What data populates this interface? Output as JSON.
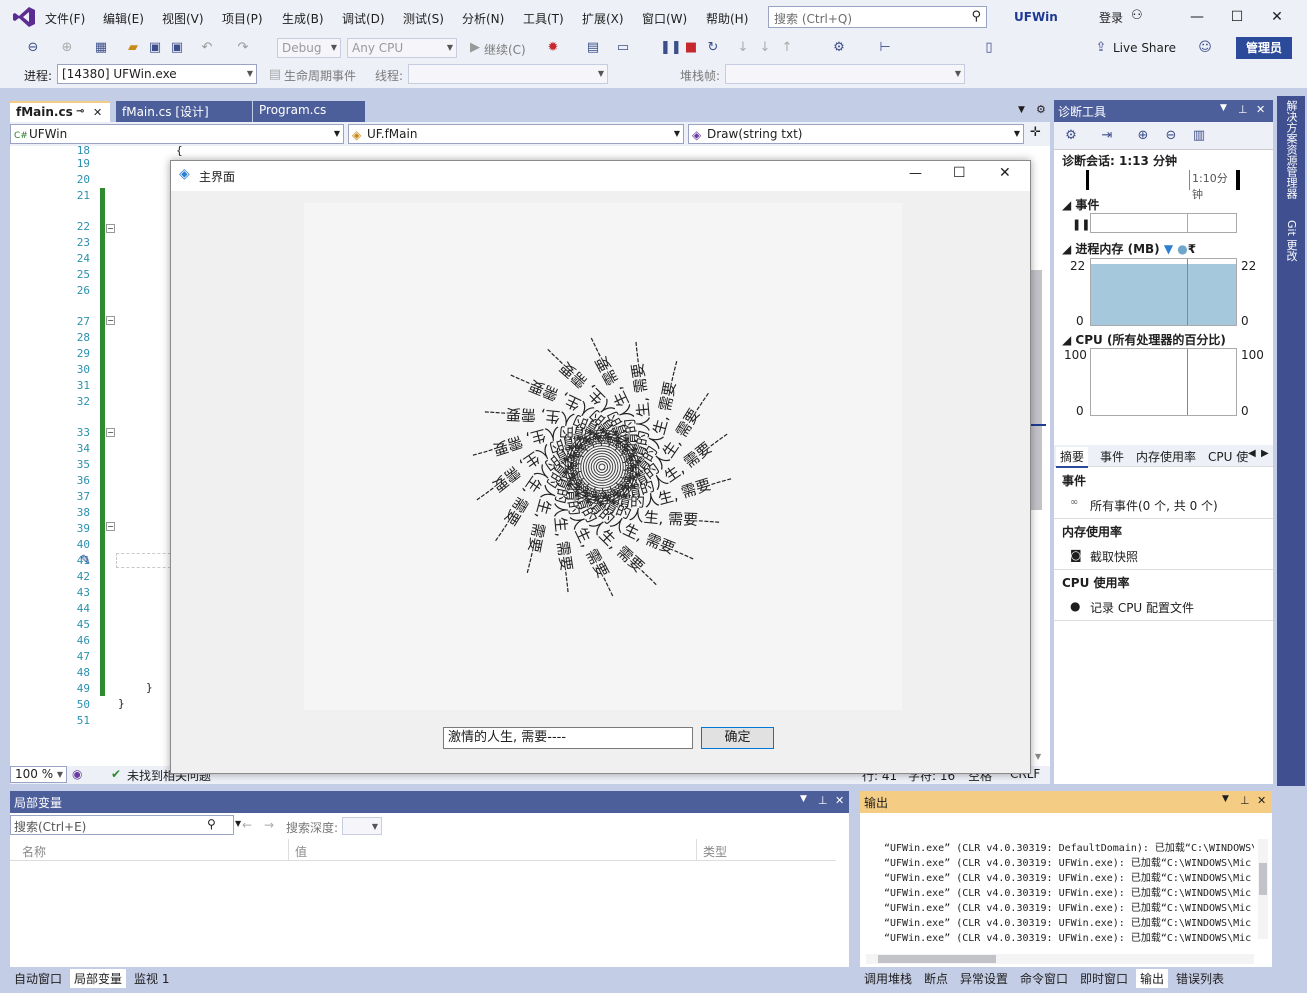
{
  "menubar": {
    "items": [
      "文件(F)",
      "编辑(E)",
      "视图(V)",
      "项目(P)",
      "生成(B)",
      "调试(D)",
      "测试(S)",
      "分析(N)",
      "工具(T)",
      "扩展(X)",
      "窗口(W)",
      "帮助(H)"
    ],
    "search_placeholder": "搜索 (Ctrl+Q)",
    "app_title": "UFWin",
    "login": "登录"
  },
  "toolbar": {
    "config": "Debug",
    "platform": "Any CPU",
    "continue": "继续(C)",
    "live_share": "Live Share",
    "admin": "管理员"
  },
  "toolbar2": {
    "process_label": "进程:",
    "process_value": "[14380] UFWin.exe",
    "lifecycle": "生命周期事件",
    "thread_label": "线程:",
    "stackframe_label": "堆栈帧:"
  },
  "editor": {
    "tabs": [
      "fMain.cs",
      "fMain.cs [设计]",
      "Program.cs"
    ],
    "nav": [
      "UFWin",
      "UF.fMain",
      "Draw(string txt)"
    ],
    "lines": [
      "18",
      "19",
      "20",
      "21",
      "22",
      "23",
      "24",
      "25",
      "26",
      "27",
      "28",
      "29",
      "30",
      "31",
      "32",
      "33",
      "34",
      "35",
      "36",
      "37",
      "38",
      "39",
      "40",
      "41",
      "42",
      "43",
      "44",
      "45",
      "46",
      "47",
      "48",
      "49",
      "50",
      "51"
    ],
    "zoom": "100 %",
    "status": "未找到相关问题",
    "pos": "行: 41",
    "col": "字符: 16",
    "mode": "空格",
    "eol": "CRLF"
  },
  "form": {
    "title": "主界面",
    "input_value": "激情的人生, 需要----",
    "ok_button": "确定",
    "spiral_text": "激情的人生, 需要----"
  },
  "diag": {
    "title": "诊断工具",
    "session": "诊断会话: 1:13 分钟",
    "timeline": "1:10分钟",
    "events_header": "事件",
    "memory_header": "进程内存 (MB)",
    "mem_max": "22",
    "mem_min": "0",
    "cpu_header": "CPU (所有处理器的百分比)",
    "cpu_max": "100",
    "cpu_min": "0",
    "tabs": [
      "摘要",
      "事件",
      "内存使用率",
      "CPU 使"
    ],
    "sec_events": "事件",
    "all_events": "所有事件(0 个, 共 0 个)",
    "sec_memory": "内存使用率",
    "snapshot": "截取快照",
    "sec_cpu": "CPU 使用率",
    "record_cpu": "记录 CPU 配置文件",
    "memory_fill": 0.92
  },
  "sidebar_right": [
    "解决方案资源管理器",
    "Git 更改"
  ],
  "locals": {
    "title": "局部变量",
    "search_placeholder": "搜索(Ctrl+E)",
    "depth_label": "搜索深度:",
    "col_name": "名称",
    "col_value": "值",
    "col_type": "类型"
  },
  "output": {
    "title": "输出",
    "lines": [
      "“UFWin.exe” (CLR v4.0.30319: DefaultDomain): 已加载“C:\\WINDOWS\\Mic",
      "“UFWin.exe” (CLR v4.0.30319: UFWin.exe): 已加载“C:\\WINDOWS\\Mic",
      "“UFWin.exe” (CLR v4.0.30319: UFWin.exe): 已加载“C:\\WINDOWS\\Mic",
      "“UFWin.exe” (CLR v4.0.30319: UFWin.exe): 已加载“C:\\WINDOWS\\Mic",
      "“UFWin.exe” (CLR v4.0.30319: UFWin.exe): 已加载“C:\\WINDOWS\\Mic",
      "“UFWin.exe” (CLR v4.0.30319: UFWin.exe): 已加载“C:\\WINDOWS\\Mic",
      "“UFWin.exe” (CLR v4.0.30319: UFWin.exe): 已加载“C:\\WINDOWS\\Mic"
    ]
  },
  "bottom_tabs_left": [
    "自动窗口",
    "局部变量",
    "监视 1"
  ],
  "bottom_tabs_right": [
    "调用堆栈",
    "断点",
    "异常设置",
    "命令窗口",
    "即时窗口",
    "输出",
    "错误列表"
  ],
  "colors": {
    "accent": "#2b4a9a",
    "panel_header": "#4d5f9b",
    "output_header": "#f5cc84",
    "change_bar": "#2e8b2e"
  }
}
